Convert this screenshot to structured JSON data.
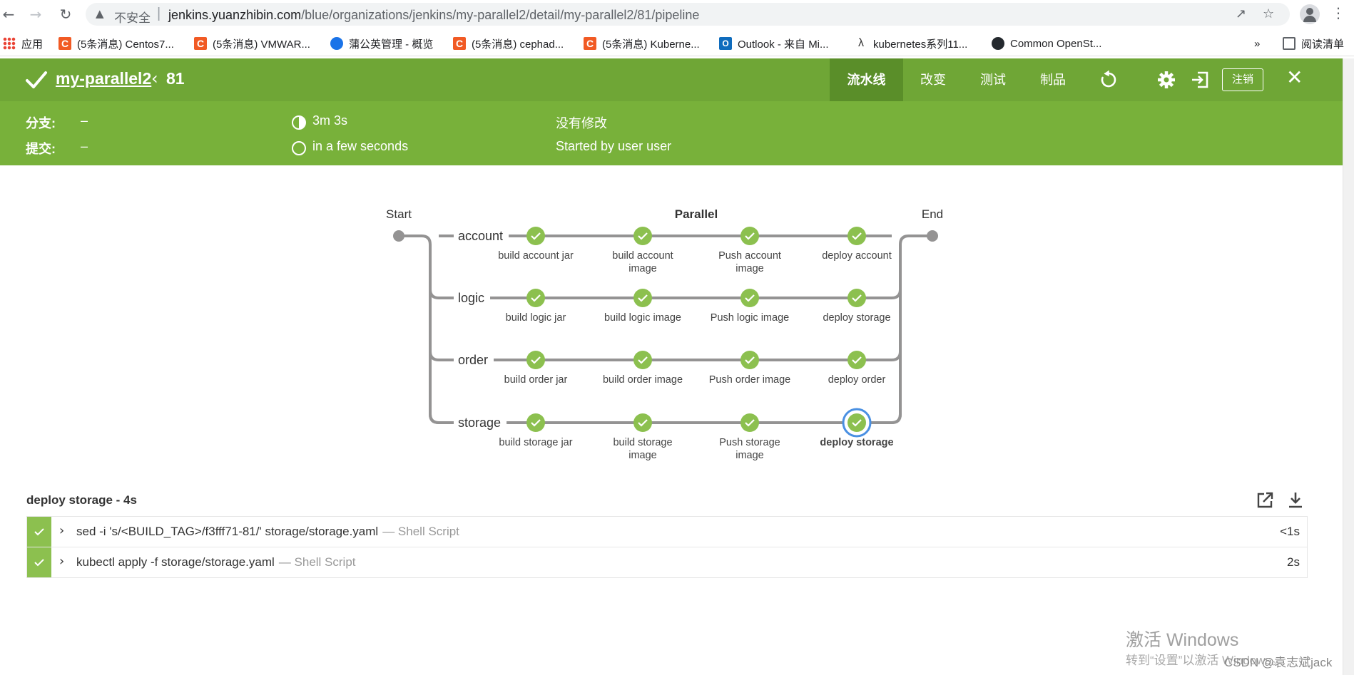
{
  "browser": {
    "insecure_label": "不安全",
    "url_host": "jenkins.yuanzhibin.com",
    "url_path": "/blue/organizations/jenkins/my-parallel2/detail/my-parallel2/81/pipeline",
    "bookmarks": [
      {
        "label": "应用",
        "icon": "apps-icon"
      },
      {
        "label": "(5条消息) Centos7...",
        "icon": "csdn-icon"
      },
      {
        "label": "(5条消息) VMWAR...",
        "icon": "csdn-icon"
      },
      {
        "label": "蒲公英管理 - 概览",
        "icon": "pgyer-icon"
      },
      {
        "label": "(5条消息) cephad...",
        "icon": "csdn-icon"
      },
      {
        "label": "(5条消息) Kuberne...",
        "icon": "csdn-icon"
      },
      {
        "label": "Outlook - 来自 Mi...",
        "icon": "outlook-icon"
      },
      {
        "label": "kubernetes系列11...",
        "icon": "k-icon"
      },
      {
        "label": "Common OpenSt...",
        "icon": "github-icon"
      }
    ],
    "more_bookmarks": "»",
    "reading_list": "阅读清单"
  },
  "run": {
    "pipeline_name": "my-parallel2",
    "run_number": "81",
    "tabs": [
      "流水线",
      "改变",
      "测试",
      "制品"
    ],
    "active_tab": "流水线",
    "logout_label": "注销",
    "branch_label": "分支:",
    "branch_value": "–",
    "commit_label": "提交:",
    "commit_value": "–",
    "duration": "3m 3s",
    "started_ago": "in a few seconds",
    "changes": "没有修改",
    "started_by": "Started by user user",
    "status_color": "#6fa636"
  },
  "graph": {
    "start_label": "Start",
    "end_label": "End",
    "parallel_label": "Parallel",
    "branches": [
      {
        "name": "account",
        "stages": [
          "build account jar",
          "build account image",
          "Push account image",
          "deploy account"
        ]
      },
      {
        "name": "logic",
        "stages": [
          "build logic jar",
          "build logic image",
          "Push logic image",
          "deploy storage"
        ]
      },
      {
        "name": "order",
        "stages": [
          "build order jar",
          "build order image",
          "Push order image",
          "deploy order"
        ]
      },
      {
        "name": "storage",
        "stages": [
          "build storage jar",
          "build storage image",
          "Push storage image",
          "deploy storage"
        ]
      }
    ],
    "selected": {
      "branch": 3,
      "stage": 3
    },
    "success_color": "#8cc04f",
    "selected_color": "#4a90e2"
  },
  "log": {
    "title": "deploy storage - 4s",
    "steps": [
      {
        "command": "sed -i 's/<BUILD_TAG>/f3fff71-81/' storage/storage.yaml",
        "type": "— Shell Script",
        "duration": "<1s"
      },
      {
        "command": "kubectl apply -f storage/storage.yaml",
        "type": "— Shell Script",
        "duration": "2s"
      }
    ]
  },
  "overlay": {
    "activate_title": "激活 Windows",
    "activate_sub": "转到“设置”以激活 Windows。",
    "credit": "CSDN @袁志斌jack"
  }
}
